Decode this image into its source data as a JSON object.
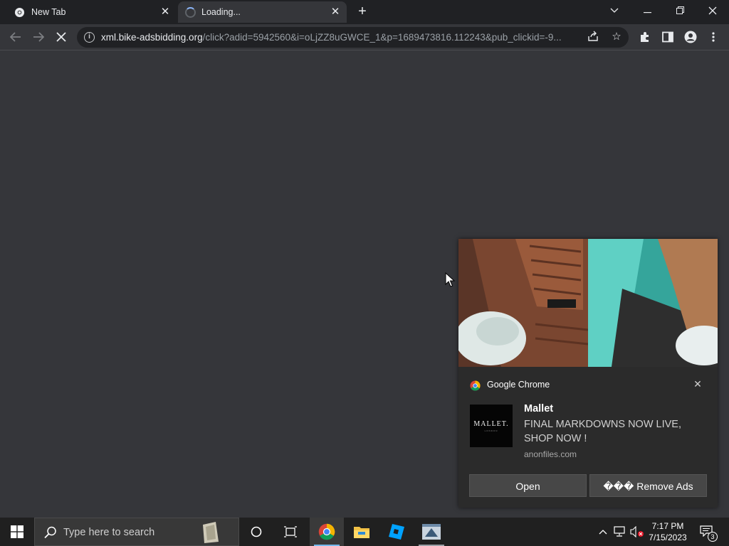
{
  "browser": {
    "tabs": [
      {
        "title": "New Tab",
        "state": "inactive"
      },
      {
        "title": "Loading...",
        "state": "loading"
      }
    ],
    "address": {
      "host": "xml.bike-adsbidding.org",
      "path": "/click?adid=5942560&i=oLjZZ8uGWCE_1&p=1689473816.112243&pub_clickid=-9..."
    }
  },
  "notification": {
    "app_name": "Google Chrome",
    "brand_logo_text": "MALLET.",
    "brand_logo_sub": "LONDON",
    "title": "Mallet",
    "body": "FINAL MARKDOWNS NOW LIVE, SHOP NOW !",
    "source": "anonfiles.com",
    "open_label": "Open",
    "remove_label": "��� Remove Ads"
  },
  "taskbar": {
    "search_placeholder": "Type here to search",
    "clock_time": "7:17 PM",
    "clock_date": "7/15/2023",
    "notification_count": "3"
  },
  "colors": {
    "page_bg": "#35363a",
    "tabstrip_bg": "#202124",
    "omnibox_bg": "#202124",
    "notification_bg": "#2b2b2b",
    "taskbar_bg": "#202020",
    "accent": "#8ab4f8"
  }
}
